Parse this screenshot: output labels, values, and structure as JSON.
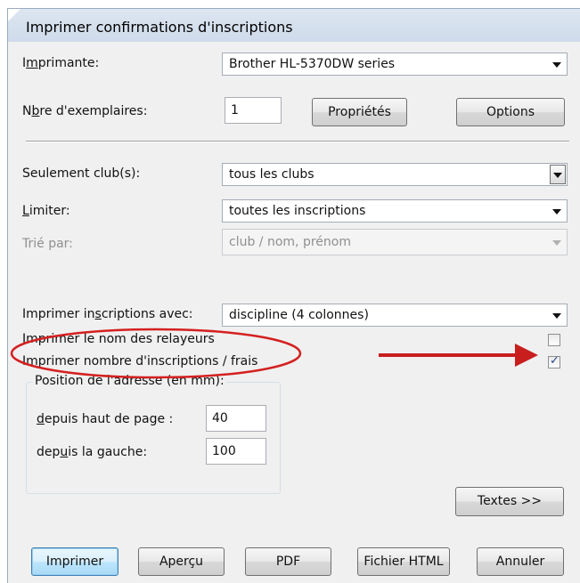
{
  "window": {
    "title": "Imprimer confirmations d'inscriptions"
  },
  "printer": {
    "label_pre": "I",
    "label_u": "m",
    "label_post": "primante:",
    "value": "Brother HL-5370DW series"
  },
  "copies": {
    "label_pre": "N",
    "label_u": "b",
    "label_post": "re d'exemplaires:",
    "value": "1"
  },
  "buttons_top": {
    "properties": "Propriétés",
    "options": "Options"
  },
  "clubs": {
    "label": "Seulement club(s):",
    "value": "tous les clubs"
  },
  "limit": {
    "label_pre": "",
    "label_u": "L",
    "label_post": "imiter:",
    "value": "toutes les inscriptions"
  },
  "sort": {
    "label": "Trié par:",
    "value": "club / nom, prénom"
  },
  "print_with": {
    "label_pre": "Imprimer in",
    "label_u": "s",
    "label_post": "criptions avec:",
    "value": "discipline (4 colonnes)"
  },
  "relay_names": {
    "label": "Imprimer le nom des relayeurs",
    "checked": false
  },
  "count_fees": {
    "label": "Imprimer nombre d'inscriptions / frais",
    "checked": true
  },
  "address": {
    "title": "Position de l'adresse (en mm):",
    "top_label_u": "d",
    "top_label_post": "epuis haut de page :",
    "top_value": "40",
    "left_label_pre": "dep",
    "left_label_u": "u",
    "left_label_post": "is la gauche:",
    "left_value": "100"
  },
  "texts_button": "Textes >>",
  "buttons_bottom": {
    "print": "Imprimer",
    "preview": "Aperçu",
    "pdf": "PDF",
    "html": "Fichier HTML",
    "cancel": "Annuler"
  },
  "annotation_colors": {
    "ellipse": "#d42020",
    "arrow": "#c81e1e"
  }
}
